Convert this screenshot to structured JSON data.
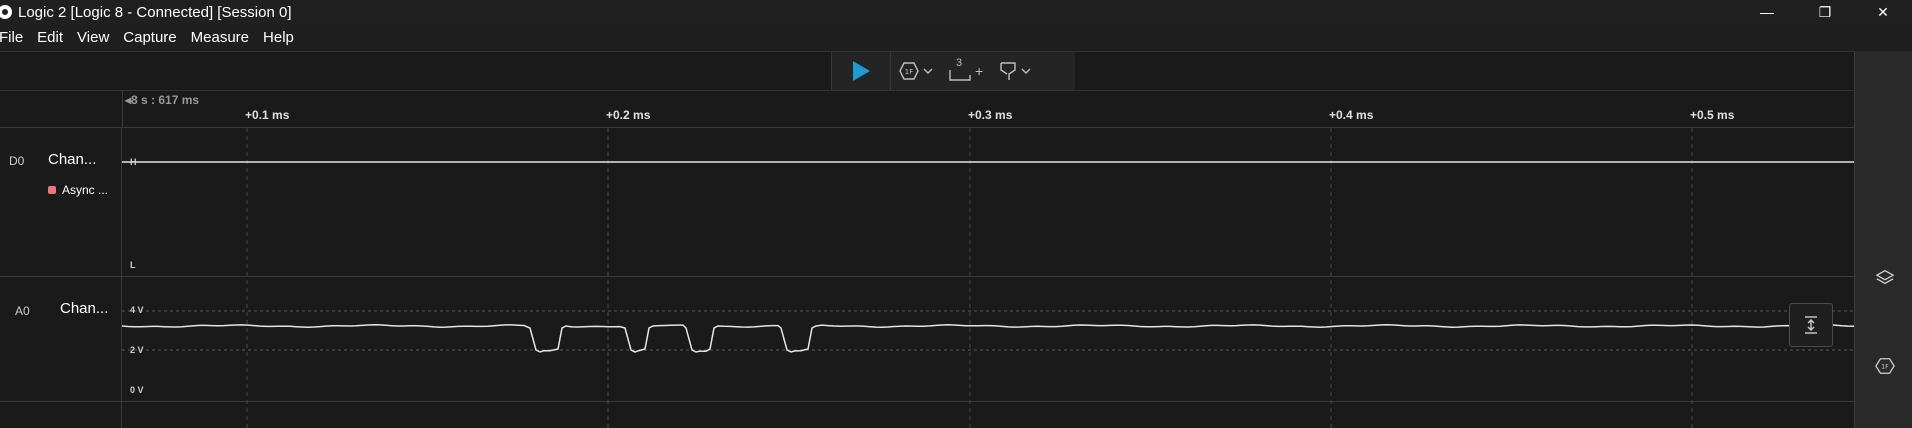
{
  "window": {
    "title": "Logic 2 [Logic 8 - Connected] [Session 0]",
    "minimize_label": "—",
    "maximize_label": "❐",
    "close_label": "✕"
  },
  "menu": [
    "File",
    "Edit",
    "View",
    "Capture",
    "Measure",
    "Help"
  ],
  "toolbar": {
    "play_icon": "play-icon",
    "trigger_icon": "trigger-icon",
    "timing_marker_count": "3",
    "timing_marker_plus": "+",
    "measure_icon": "measure-icon",
    "accent_color": "#1e9bd7"
  },
  "ruler": {
    "origin": "8 s : 617 ms",
    "ticks": [
      "+0.1 ms",
      "+0.2 ms",
      "+0.3 ms",
      "+0.4 ms",
      "+0.5 ms"
    ]
  },
  "channels": [
    {
      "id": "D0",
      "name": "Chan...",
      "analyzer": "Async ...",
      "analyzer_color": "#e57a80",
      "high_label": "H",
      "low_label": "L"
    },
    {
      "id": "A0",
      "name": "Chan...",
      "voltage_labels": [
        "4 V",
        "2 V",
        "0 V"
      ]
    }
  ],
  "sidebar_icons": [
    "layers-icon",
    "analyzer-icon"
  ]
}
